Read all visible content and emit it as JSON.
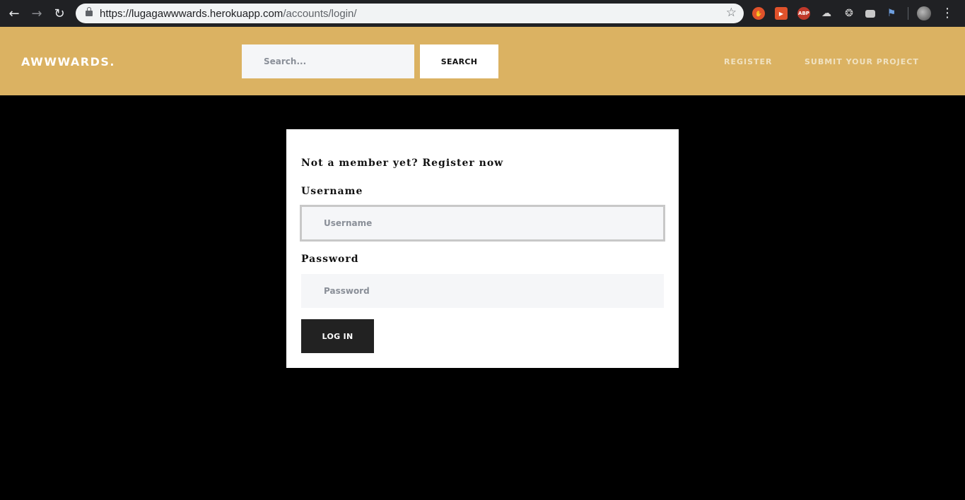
{
  "browser": {
    "url_host": "https://lugagawwwards.herokuapp.com",
    "url_path": "/accounts/login/",
    "extensions": [
      "hand-icon",
      "video-icon",
      "ABP",
      "cloud-icon",
      "film-icon",
      "camera-icon",
      "flag-icon"
    ]
  },
  "header": {
    "brand": "AWWWARDS.",
    "search_placeholder": "Search...",
    "search_button": "SEARCH",
    "nav_register": "REGISTER",
    "nav_submit": "SUBMIT YOUR PROJECT"
  },
  "login": {
    "prompt_text": "Not a member yet? ",
    "prompt_link": "Register now",
    "username_label": "Username",
    "username_placeholder": "Username",
    "password_label": "Password",
    "password_placeholder": "Password",
    "login_button": "LOG IN"
  },
  "colors": {
    "header_bg": "#dbb262",
    "page_bg": "#000000",
    "button_dark": "#222222"
  }
}
